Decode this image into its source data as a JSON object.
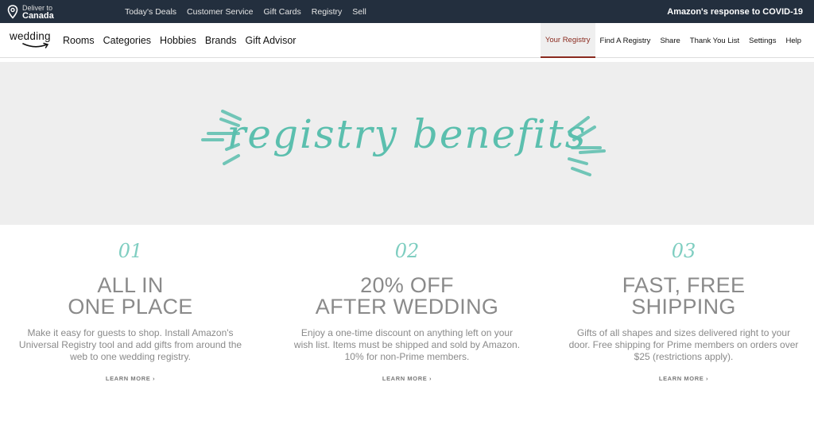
{
  "topbar": {
    "deliver_line1": "Deliver to",
    "deliver_line2": "Canada",
    "links": [
      "Today's Deals",
      "Customer Service",
      "Gift Cards",
      "Registry",
      "Sell"
    ],
    "covid_link": "Amazon's response to COVID-19",
    "background": "#232f3e"
  },
  "subbar": {
    "logo_text": "wedding",
    "nav": [
      "Rooms",
      "Categories",
      "Hobbies",
      "Brands",
      "Gift Advisor"
    ],
    "right_nav": [
      "Your Registry",
      "Find A Registry",
      "Share",
      "Thank You List",
      "Settings",
      "Help"
    ],
    "active": "Your Registry",
    "active_color": "#8a2a1e"
  },
  "banner": {
    "title": "registry benefits",
    "accent": "#5bbfae"
  },
  "benefits": [
    {
      "number": "01",
      "head_line1": "ALL IN",
      "head_line2": "ONE PLACE",
      "body": "Make it easy for guests to shop. Install Amazon's Universal Registry tool and add gifts from around the web to one wedding registry.",
      "link": "LEARN MORE ›"
    },
    {
      "number": "02",
      "head_line1": "20% OFF",
      "head_line2": "AFTER WEDDING",
      "body": "Enjoy a one-time discount on anything left on your wish list. Items must be shipped and sold by Amazon. 10% for non-Prime members.",
      "link": "LEARN MORE ›"
    },
    {
      "number": "03",
      "head_line1": "FAST, FREE",
      "head_line2": "SHIPPING",
      "body": "Gifts of all shapes and sizes delivered right to your door. Free shipping for Prime members on orders over $25 (restrictions apply).",
      "link": "LEARN MORE ›"
    }
  ]
}
